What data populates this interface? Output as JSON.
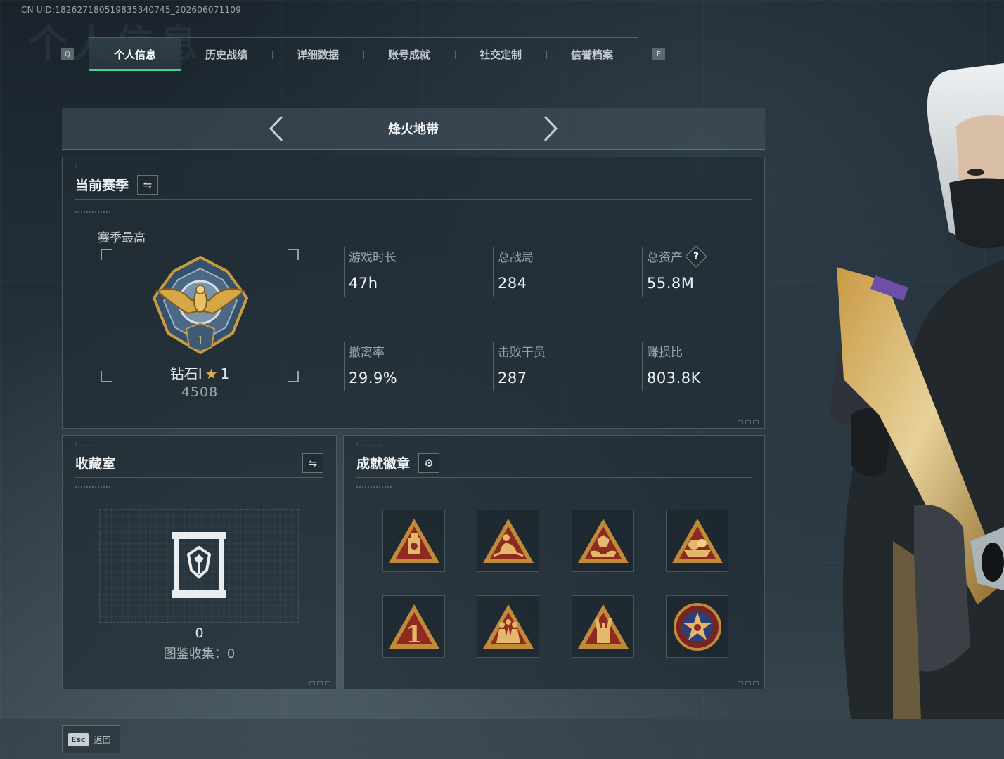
{
  "uid": "CN UID:1826271805198353407​45_202606071109",
  "tabs": [
    {
      "label": "个人信息",
      "active": true
    },
    {
      "label": "历史战绩",
      "active": false
    },
    {
      "label": "详细数据",
      "active": false
    },
    {
      "label": "账号成就",
      "active": false
    },
    {
      "label": "社交定制",
      "active": false
    },
    {
      "label": "信誉档案",
      "active": false
    }
  ],
  "keys": {
    "left": "Q",
    "right": "E"
  },
  "mode": {
    "title": "烽火地带",
    "prev_icon": "chevron-left-icon",
    "next_icon": "chevron-right-icon"
  },
  "season": {
    "title": "当前赛季",
    "best_label": "赛季最高",
    "rank_name": "钻石I",
    "rank_stars": "1",
    "rank_score": "4508",
    "stats": [
      {
        "label": "游戏时长",
        "value": "47h"
      },
      {
        "label": "总战局",
        "value": "284"
      },
      {
        "label": "总资产",
        "value": "55.8M",
        "help": "?"
      },
      {
        "label": "撤离率",
        "value": "29.9%"
      },
      {
        "label": "击败干员",
        "value": "287"
      },
      {
        "label": "赚损比",
        "value": "803.8K"
      }
    ]
  },
  "collection": {
    "title": "收藏室",
    "count": "0",
    "codex_label": "图鉴收集：0"
  },
  "achievements": {
    "title": "成就徽章",
    "badges": [
      "lantern-badge-icon",
      "archer-badge-icon",
      "hands-gem-badge-icon",
      "treasure-badge-icon",
      "number-one-badge-icon",
      "squad-badge-icon",
      "rock-hand-badge-icon",
      "star-seal-badge-icon"
    ]
  },
  "footer": {
    "esc_key": "Esc",
    "back_label": "返回"
  },
  "colors": {
    "accent": "#3ed28a",
    "gold": "#e1b24a",
    "badge_red": "#8e2a20"
  }
}
